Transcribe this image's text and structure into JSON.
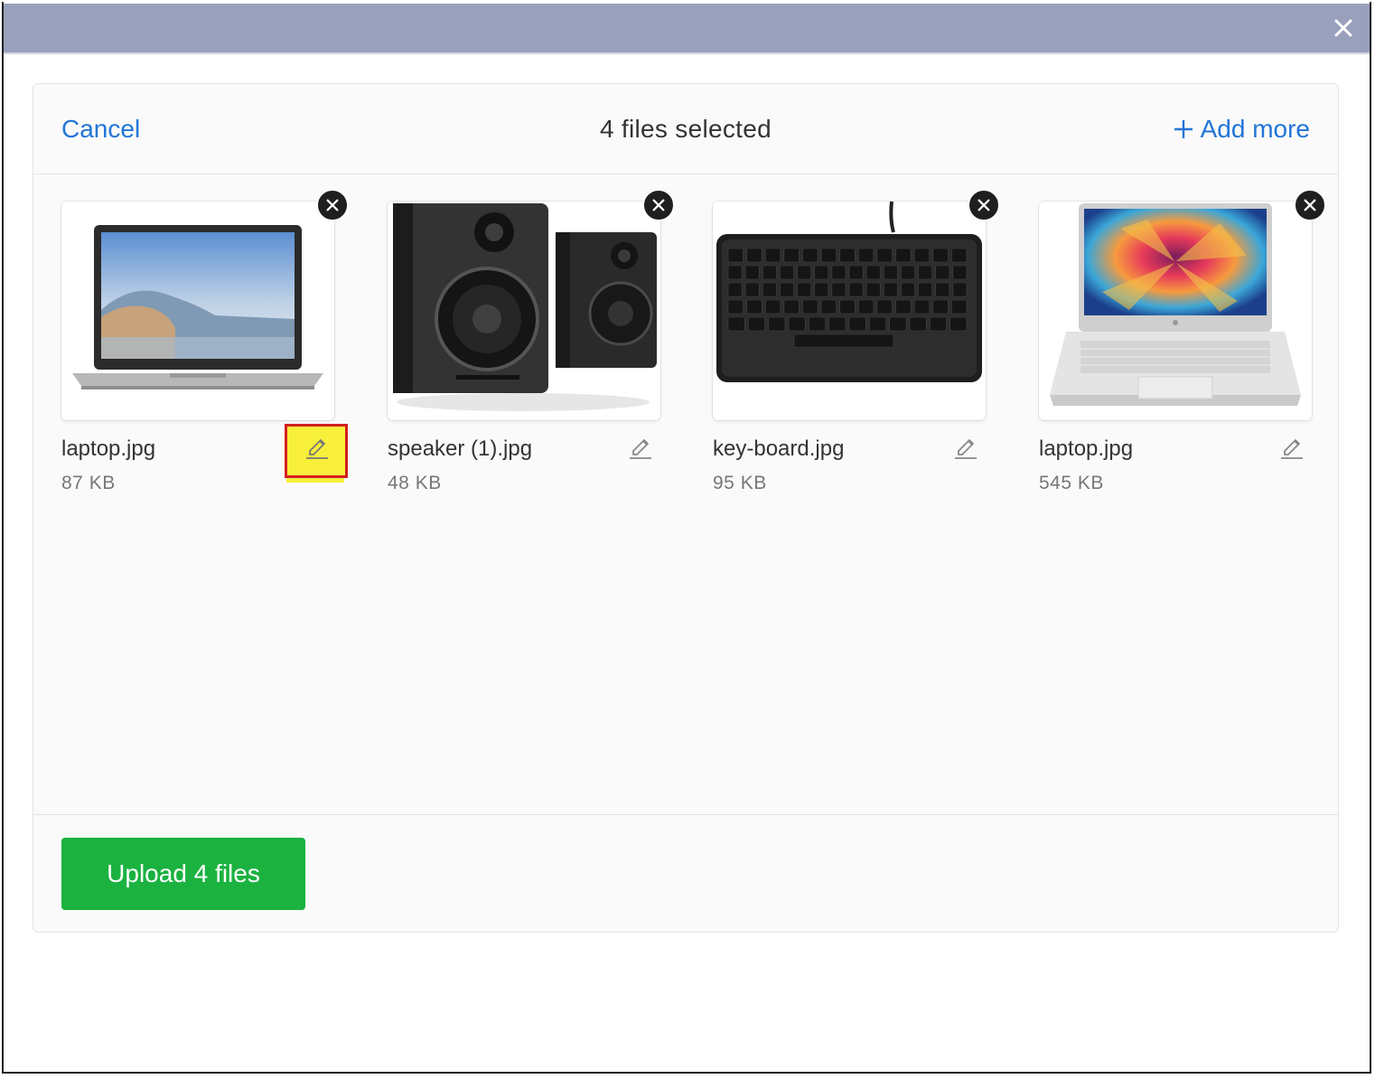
{
  "header": {
    "cancel_label": "Cancel",
    "title": "4 files selected",
    "add_more_label": "Add more"
  },
  "files": [
    {
      "name": "laptop.jpg",
      "size": "87 KB",
      "image": "laptop-silver-icon"
    },
    {
      "name": "speaker (1).jpg",
      "size": "48 KB",
      "image": "speakers-icon"
    },
    {
      "name": "key-board.jpg",
      "size": "95 KB",
      "image": "keyboard-icon"
    },
    {
      "name": "laptop.jpg",
      "size": "545 KB",
      "image": "laptop-colorful-icon"
    }
  ],
  "footer": {
    "upload_label": "Upload 4 files"
  },
  "colors": {
    "titlebar": "#98a0bd",
    "link": "#2275d7",
    "upload_button": "#1bb240",
    "highlight_fill": "#f7ef3a",
    "highlight_border": "#d21f1f"
  }
}
